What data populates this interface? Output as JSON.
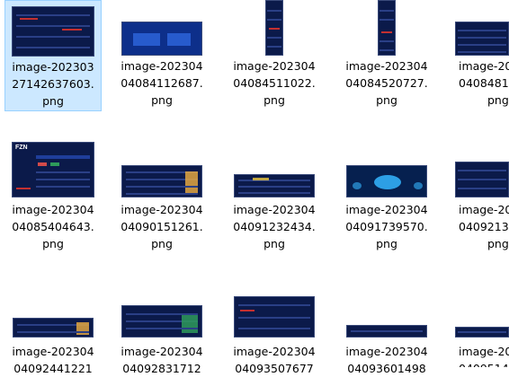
{
  "files": [
    {
      "line1": "image-202303",
      "line2": "27142637603.",
      "line3": "png",
      "selected": true
    },
    {
      "line1": "image-202304",
      "line2": "04084112687.",
      "line3": "png",
      "selected": false
    },
    {
      "line1": "image-202304",
      "line2": "04084511022.",
      "line3": "png",
      "selected": false
    },
    {
      "line1": "image-202304",
      "line2": "04084520727.",
      "line3": "png",
      "selected": false
    },
    {
      "line1": "image-202",
      "line2": "0408481",
      "line3": "png",
      "selected": false
    },
    {
      "line1": "image-202304",
      "line2": "04085404643.",
      "line3": "png",
      "selected": false
    },
    {
      "line1": "image-202304",
      "line2": "04090151261.",
      "line3": "png",
      "selected": false
    },
    {
      "line1": "image-202304",
      "line2": "04091232434.",
      "line3": "png",
      "selected": false
    },
    {
      "line1": "image-202304",
      "line2": "04091739570.",
      "line3": "png",
      "selected": false
    },
    {
      "line1": "image-202",
      "line2": "0409213",
      "line3": "png",
      "selected": false
    },
    {
      "line1": "image-202304",
      "line2": "04092441221",
      "line3": "",
      "selected": false
    },
    {
      "line1": "image-202304",
      "line2": "04092831712",
      "line3": "",
      "selected": false
    },
    {
      "line1": "image-202304",
      "line2": "04093507677",
      "line3": "",
      "selected": false
    },
    {
      "line1": "image-202304",
      "line2": "04093601498",
      "line3": "",
      "selected": false
    },
    {
      "line1": "image-20",
      "line2": "0409514",
      "line3": "",
      "selected": false
    }
  ],
  "thumb_text": {
    "brand": "FZN"
  },
  "colors": {
    "selection_bg": "#cce8ff",
    "thumb_bg": "#0b1a4a",
    "accent": "#c43030",
    "highlight": "#35b6ff"
  }
}
